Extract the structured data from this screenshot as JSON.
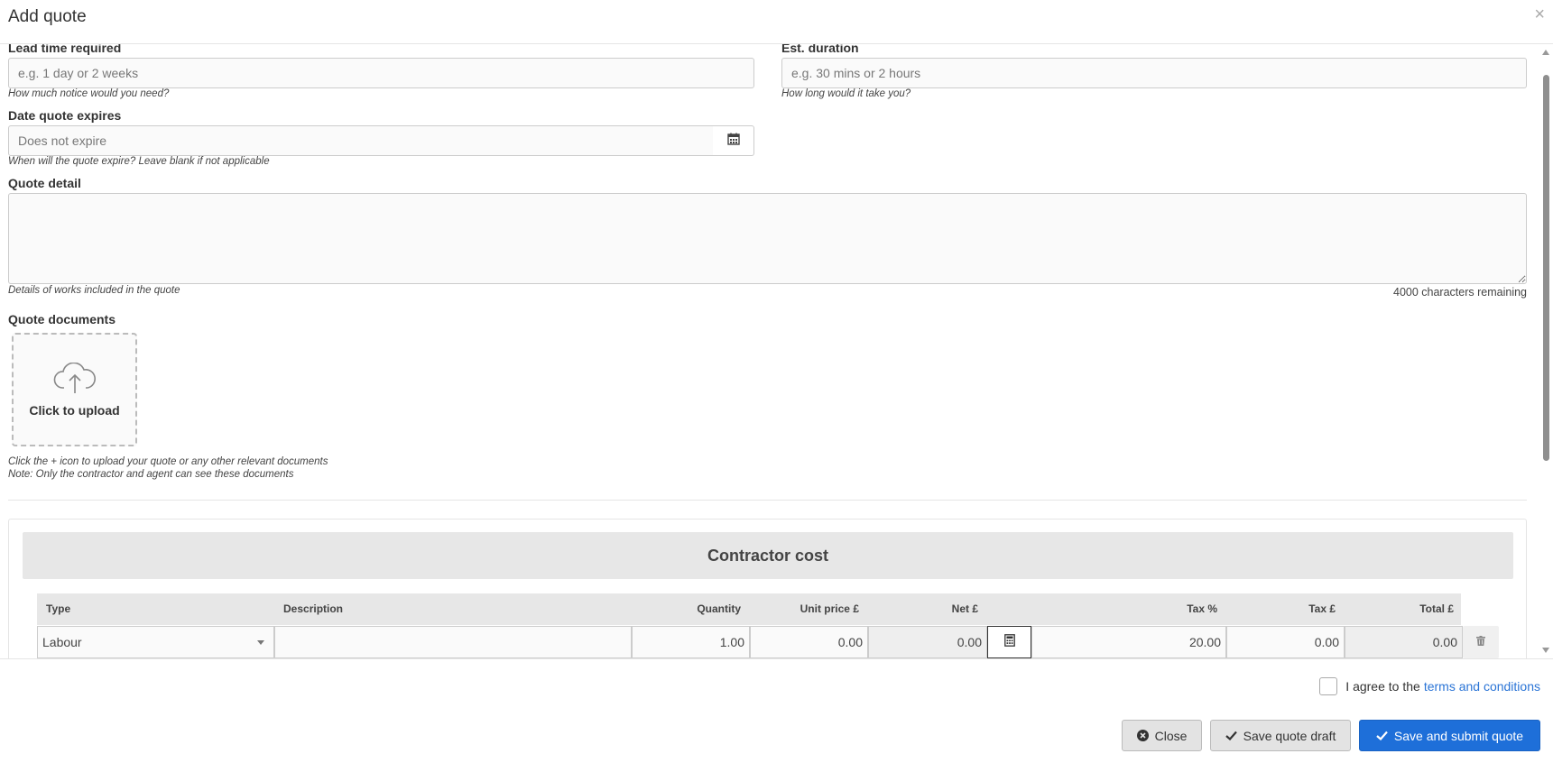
{
  "dialog": {
    "title": "Add quote",
    "close_symbol": "×"
  },
  "form": {
    "lead_time": {
      "label": "Lead time required",
      "placeholder": "e.g. 1 day or 2 weeks",
      "help": "How much notice would you need?"
    },
    "est_duration": {
      "label": "Est. duration",
      "placeholder": "e.g. 30 mins or 2 hours",
      "help": "How long would it take you?"
    },
    "date_expires": {
      "label": "Date quote expires",
      "placeholder": "Does not expire",
      "help": "When will the quote expire? Leave blank if not applicable"
    },
    "quote_detail": {
      "label": "Quote detail",
      "value": "",
      "help": "Details of works included in the quote",
      "chars_remaining": "4000 characters remaining"
    },
    "documents": {
      "label": "Quote documents",
      "upload_text": "Click to upload",
      "help_line1": "Click the + icon to upload your quote or any other relevant documents",
      "help_line2": "Note: Only the contractor and agent can see these documents"
    }
  },
  "cost": {
    "heading": "Contractor cost",
    "columns": {
      "type": "Type",
      "description": "Description",
      "quantity": "Quantity",
      "unit_price": "Unit price £",
      "net": "Net £",
      "tax_pct": "Tax %",
      "tax": "Tax £",
      "total": "Total £"
    },
    "rows": [
      {
        "type": "Labour",
        "description": "",
        "quantity": "1.00",
        "unit_price": "0.00",
        "net": "0.00",
        "tax_pct": "20.00",
        "tax": "0.00",
        "total": "0.00"
      }
    ]
  },
  "footer": {
    "agree_text": "I agree to the",
    "terms_link": "terms and conditions",
    "agree_checked": false,
    "close_label": "Close",
    "save_draft_label": "Save quote draft",
    "submit_label": "Save and submit quote"
  },
  "colors": {
    "primary": "#1e6fd9",
    "link": "#2a74d6",
    "panel_header": "#e7e7e7"
  }
}
